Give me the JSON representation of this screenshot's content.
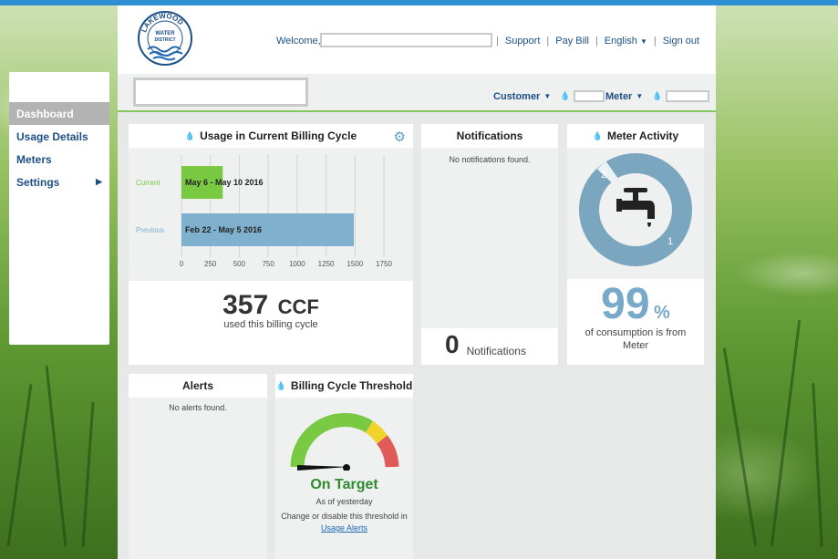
{
  "header": {
    "logo_text": "LAKEWOOD WATER DISTRICT",
    "welcome_label": "Welcome,",
    "links": {
      "support": "Support",
      "pay_bill": "Pay Bill",
      "language": "English",
      "sign_out": "Sign out"
    }
  },
  "subbar": {
    "customer_label": "Customer",
    "meter_label": "Meter"
  },
  "sidebar": {
    "items": [
      {
        "label": "Dashboard"
      },
      {
        "label": "Usage Details"
      },
      {
        "label": "Meters"
      },
      {
        "label": "Settings"
      }
    ]
  },
  "usage_card": {
    "title": "Usage in Current Billing Cycle",
    "current_label": "Current",
    "previous_label": "Previous",
    "current_range": "May 6 - May 10 2016",
    "previous_range": "Feb 22 - May 5 2016",
    "amount": "357",
    "unit": "CCF",
    "caption": "used this billing cycle"
  },
  "chart_data": {
    "type": "bar",
    "orientation": "horizontal",
    "categories": [
      "Current",
      "Previous"
    ],
    "values": [
      357,
      1490
    ],
    "bar_labels": [
      "May 6 - May 10 2016",
      "Feb 22 - May 5 2016"
    ],
    "xlim": [
      0,
      1750
    ],
    "xticks": [
      "0",
      "250",
      "500",
      "750",
      "1000",
      "1250",
      "1500",
      "1750"
    ],
    "grid": true,
    "colors": [
      "#7ac943",
      "#7fb1ce"
    ]
  },
  "notifications_card": {
    "title": "Notifications",
    "empty_text": "No notifications found.",
    "count": "0",
    "count_label": "Notifications"
  },
  "meter_card": {
    "title": "Meter Activity",
    "ring_label_top": "2",
    "ring_label_bottom": "1",
    "percent": "99",
    "percent_sign": "%",
    "caption": "of consumption is from Meter"
  },
  "alerts_card": {
    "title": "Alerts",
    "empty_text": "No alerts found."
  },
  "threshold_card": {
    "title": "Billing Cycle Threshold",
    "status": "On Target",
    "as_of": "As of yesterday",
    "change_text": "Change or disable this threshold in",
    "link_text": "Usage Alerts"
  },
  "colors": {
    "brand_blue": "#1d4f86",
    "accent_green": "#7ac943",
    "accent_blue": "#7fb1ce",
    "status_green": "#2e8b2e"
  }
}
